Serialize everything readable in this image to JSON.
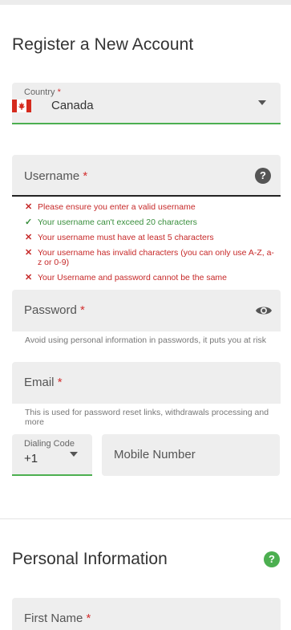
{
  "headings": {
    "register": "Register a New Account",
    "personal": "Personal Information"
  },
  "country": {
    "label": "Country",
    "required": "*",
    "value": "Canada",
    "flag_icon": "canada-flag-icon"
  },
  "username": {
    "label": "Username",
    "required": "*",
    "help_icon": "?",
    "checks": [
      {
        "status": "error",
        "mark": "✕",
        "text": "Please ensure you enter a valid username"
      },
      {
        "status": "ok",
        "mark": "✓",
        "text": "Your username can't exceed 20 characters"
      },
      {
        "status": "error",
        "mark": "✕",
        "text": "Your username must have at least 5 characters"
      },
      {
        "status": "error",
        "mark": "✕",
        "text": "Your username has invalid characters (you can only use A-Z, a-z or 0-9)"
      },
      {
        "status": "error",
        "mark": "✕",
        "text": "Your Username and password cannot be the same"
      }
    ]
  },
  "password": {
    "label": "Password",
    "required": "*",
    "hint": "Avoid using personal information in passwords, it puts you at risk"
  },
  "email": {
    "label": "Email",
    "required": "*",
    "hint": "This is used for password reset links, withdrawals processing and more"
  },
  "dialing": {
    "label": "Dialing Code",
    "value": "+1"
  },
  "mobile": {
    "placeholder": "Mobile Number"
  },
  "first_name": {
    "label": "First Name",
    "required": "*"
  },
  "colors": {
    "accent_green": "#4caf50",
    "error_red": "#c62828",
    "field_bg": "#eeeeee"
  }
}
